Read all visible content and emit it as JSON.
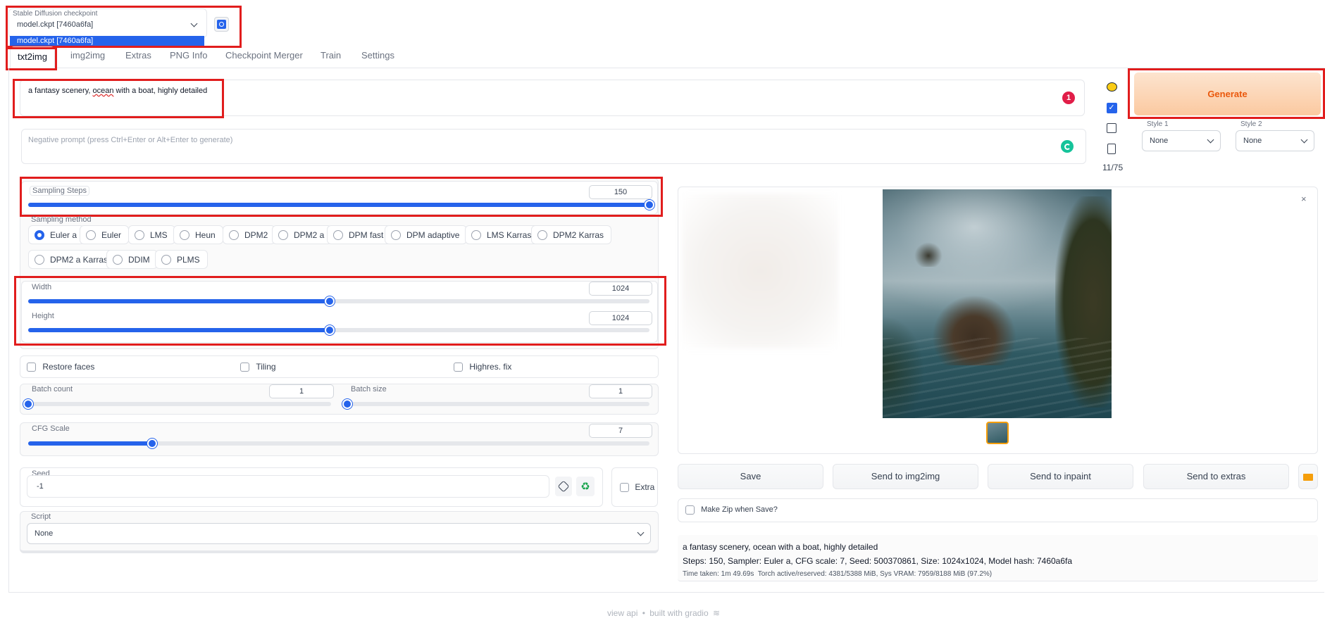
{
  "checkpoint": {
    "label": "Stable Diffusion checkpoint",
    "value": "model.ckpt [7460a6fa]",
    "dropdown_option": "model.ckpt [7460a6fa]"
  },
  "tabs": [
    "txt2img",
    "img2img",
    "Extras",
    "PNG Info",
    "Checkpoint Merger",
    "Train",
    "Settings"
  ],
  "prompt": {
    "value_pre": "a fantasy scenery, ",
    "value_word": "ocean",
    "value_post": " with a boat, highly detailed",
    "badge": "1"
  },
  "negative_prompt": {
    "placeholder": "Negative prompt (press Ctrl+Enter or Alt+Enter to generate)"
  },
  "token_count": "11/75",
  "generate_label": "Generate",
  "styles": [
    {
      "label": "Style 1",
      "value": "None"
    },
    {
      "label": "Style 2",
      "value": "None"
    }
  ],
  "sampling_steps": {
    "label": "Sampling Steps",
    "value": "150",
    "fraction": 1.0
  },
  "sampling_method": {
    "label": "Sampling method",
    "options": [
      "Euler a",
      "Euler",
      "LMS",
      "Heun",
      "DPM2",
      "DPM2 a",
      "DPM fast",
      "DPM adaptive",
      "LMS Karras",
      "DPM2 Karras",
      "DPM2 a Karras",
      "DDIM",
      "PLMS"
    ],
    "selected": "Euler a"
  },
  "width": {
    "label": "Width",
    "value": "1024",
    "fraction": 0.485
  },
  "height": {
    "label": "Height",
    "value": "1024",
    "fraction": 0.485
  },
  "checkboxes": {
    "restore_faces": "Restore faces",
    "tiling": "Tiling",
    "highres_fix": "Highres. fix"
  },
  "batch_count": {
    "label": "Batch count",
    "value": "1",
    "fraction": 0.0
  },
  "batch_size": {
    "label": "Batch size",
    "value": "1",
    "fraction": 0.0
  },
  "cfg_scale": {
    "label": "CFG Scale",
    "value": "7",
    "fraction": 0.2
  },
  "seed": {
    "label": "Seed",
    "value": "-1",
    "extra_label": "Extra"
  },
  "script": {
    "label": "Script",
    "value": "None"
  },
  "output_buttons": [
    "Save",
    "Send to img2img",
    "Send to inpaint",
    "Send to extras"
  ],
  "make_zip_label": "Make Zip when Save?",
  "info": {
    "prompt": "a fantasy scenery, ocean with a boat, highly detailed",
    "params": "Steps: 150, Sampler: Euler a, CFG scale: 7, Seed: 500370861, Size: 1024x1024, Model hash: 7460a6fa",
    "timing": "Time taken: 1m 49.69s  Torch active/reserved: 4381/5388 MiB, Sys VRAM: 7959/8188 MiB (97.2%)"
  },
  "footer": {
    "api": "view api",
    "sep": "•",
    "built": "built with gradio"
  },
  "colors": {
    "accent": "#2563eb",
    "generate": "#f97316",
    "highlight": "#e11d1d"
  }
}
